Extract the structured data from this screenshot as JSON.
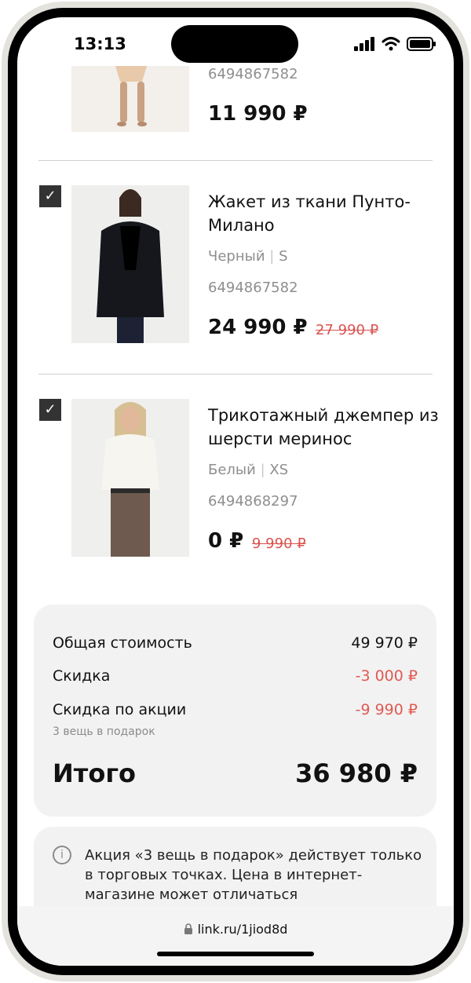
{
  "status": {
    "time": "13:13"
  },
  "items": [
    {
      "sku": "6494867582",
      "price": "11 990 ₽"
    },
    {
      "title": "Жакет из ткани Пунто-Милано",
      "color": "Черный",
      "size": "S",
      "sku": "6494867582",
      "price": "24 990 ₽",
      "old_price": "27 990 ₽"
    },
    {
      "title": "Трикотажный джемпер из шерсти меринос",
      "color": "Белый",
      "size": "XS",
      "sku": "6494868297",
      "price": "0 ₽",
      "old_price": "9 990 ₽"
    }
  ],
  "separator": "|",
  "checkmark": "✓",
  "summary": {
    "total_cost_label": "Общая стоимость",
    "total_cost_value": "49 970 ₽",
    "discount_label": "Скидка",
    "discount_value": "-3 000 ₽",
    "promo_label": "Скидка по акции",
    "promo_value": "-9 990 ₽",
    "promo_sub": "3 вещь в подарок",
    "grand_label": "Итого",
    "grand_value": "36 980 ₽"
  },
  "notice": {
    "icon": "info-icon",
    "text": "Акция «3 вещь в подарок» действует только в торговых точках. Цена в интернет-магазине может отличаться"
  },
  "browser": {
    "url": "link.ru/1jiod8d",
    "lock_icon": "lock-icon"
  },
  "colors": {
    "discount_red": "#e05a52",
    "panel": "#f2f2f2",
    "checkbox": "#333333"
  }
}
